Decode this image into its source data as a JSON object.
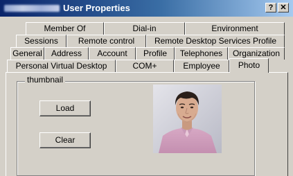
{
  "window": {
    "title": "User Properties",
    "help_glyph": "?",
    "close_glyph": "✕"
  },
  "tabs": {
    "row1": [
      "Member Of",
      "Dial-in",
      "Environment"
    ],
    "row2": [
      "Sessions",
      "Remote control",
      "Remote Desktop Services Profile"
    ],
    "row3": [
      "General",
      "Address",
      "Account",
      "Profile",
      "Telephones",
      "Organization"
    ],
    "row4": [
      "Personal Virtual Desktop",
      "COM+",
      "Employee",
      "Photo"
    ],
    "active": "Photo"
  },
  "thumbnail": {
    "group_label": "thumbnail",
    "load_label": "Load",
    "clear_label": "Clear",
    "photo_icon": "user-photo"
  },
  "colors": {
    "face": "#d4d0c8",
    "title_start": "#0a246a",
    "title_end": "#a6caf0"
  }
}
